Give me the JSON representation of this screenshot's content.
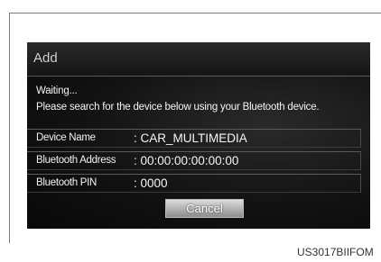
{
  "dialog": {
    "title": "Add",
    "message_line1": "Waiting...",
    "message_line2": "Please search for the device below using your Bluetooth device.",
    "fields": [
      {
        "label": "Device Name",
        "value": ": CAR_MULTIMEDIA"
      },
      {
        "label": "Bluetooth Address",
        "value": ": 00:00:00:00:00:00"
      },
      {
        "label": "Bluetooth PIN",
        "value": ": 0000"
      }
    ],
    "cancel_label": "Cancel"
  },
  "figure_code": "US3017BIIFOM"
}
